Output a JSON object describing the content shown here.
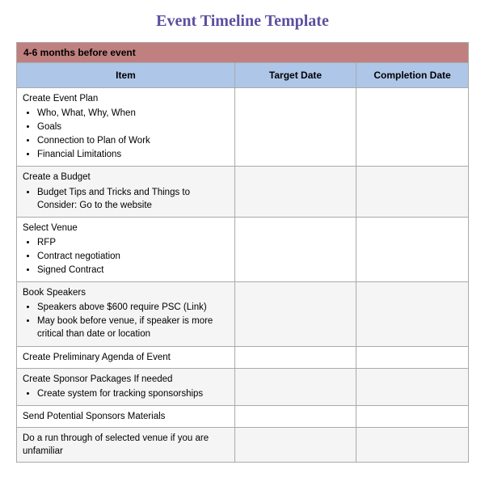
{
  "title": "Event Timeline Template",
  "section": {
    "label": "4-6 months before event"
  },
  "columns": {
    "item": "Item",
    "target": "Target Date",
    "completion": "Completion Date"
  },
  "rows": [
    {
      "id": 1,
      "item_main": "Create Event Plan",
      "bullets": [
        "Who, What, Why, When",
        "Goals",
        "Connection to Plan of Work",
        "Financial Limitations"
      ],
      "bg": "white"
    },
    {
      "id": 2,
      "item_main": "Create a Budget",
      "bullets": [
        "Budget Tips and Tricks and Things to Consider: Go to the website"
      ],
      "bg": "light"
    },
    {
      "id": 3,
      "item_main": "Select Venue",
      "bullets": [
        "RFP",
        "Contract negotiation",
        "Signed Contract"
      ],
      "bg": "white"
    },
    {
      "id": 4,
      "item_main": "Book Speakers",
      "bullets": [
        "Speakers above $600 require PSC (Link)",
        "May book before venue, if speaker is more critical than date or location"
      ],
      "bg": "light"
    },
    {
      "id": 5,
      "item_main": "Create Preliminary Agenda  of Event",
      "bullets": [],
      "bg": "white"
    },
    {
      "id": 6,
      "item_main": "Create Sponsor Packages If needed",
      "bullets": [
        "Create system for tracking sponsorships"
      ],
      "bg": "light"
    },
    {
      "id": 7,
      "item_main": "Send Potential Sponsors Materials",
      "bullets": [],
      "bg": "white"
    },
    {
      "id": 8,
      "item_main": "Do a run through of selected  venue if you are unfamiliar",
      "bullets": [],
      "bg": "light"
    }
  ]
}
